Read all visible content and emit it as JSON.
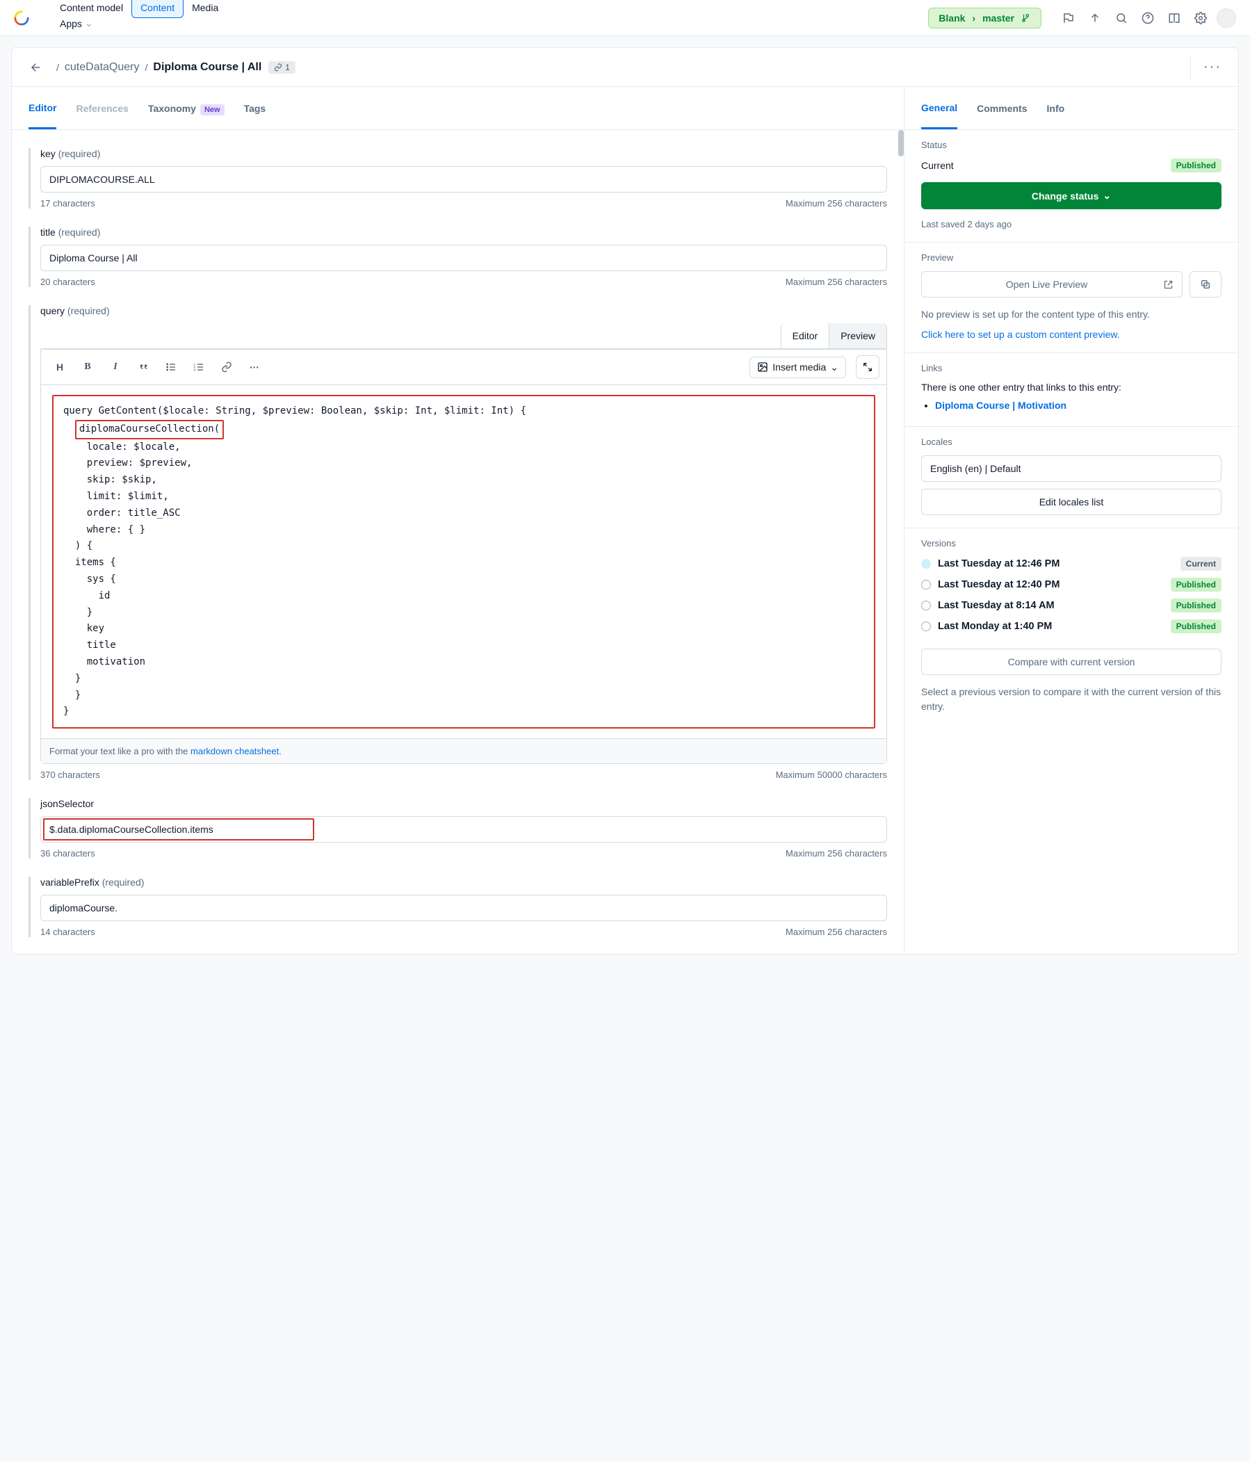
{
  "nav": {
    "items": [
      "Content model",
      "Content",
      "Media",
      "Apps"
    ],
    "active_index": 1
  },
  "env": {
    "space": "Blank",
    "branch": "master"
  },
  "header": {
    "breadcrumb": "cuteDataQuery",
    "title": "Diploma Course | All",
    "link_count": "1"
  },
  "main_tabs": {
    "items": [
      "Editor",
      "References",
      "Taxonomy",
      "Tags"
    ],
    "active_index": 0,
    "new_badge_index": 2,
    "new_label": "New",
    "disabled_index": 1
  },
  "fields": {
    "required_label": "(required)",
    "key": {
      "label": "key",
      "value": "DIPLOMACOURSE.ALL",
      "count": "17 characters",
      "max": "Maximum 256 characters"
    },
    "title": {
      "label": "title",
      "value": "Diploma Course | All",
      "count": "20 characters",
      "max": "Maximum 256 characters"
    },
    "query": {
      "label": "query",
      "tab_editor": "Editor",
      "tab_preview": "Preview",
      "insert_media": "Insert media",
      "code_line1": "query GetContent($locale: String, $preview: Boolean, $skip: Int, $limit: Int) {",
      "code_highlight": "diplomaCourseCollection(",
      "code_rest": "    locale: $locale,\n    preview: $preview,\n    skip: $skip,\n    limit: $limit,\n    order: title_ASC\n    where: { }\n  ) {\n  items {\n    sys {\n      id\n    }\n    key\n    title\n    motivation\n  }\n  }\n}",
      "md_hint_pre": "Format your text like a pro with the ",
      "md_hint_link": "markdown cheatsheet",
      "md_hint_post": ".",
      "count": "370 characters",
      "max": "Maximum 50000 characters"
    },
    "jsonSelector": {
      "label": "jsonSelector",
      "value": "$.data.diplomaCourseCollection.items",
      "count": "36 characters",
      "max": "Maximum 256 characters"
    },
    "variablePrefix": {
      "label": "variablePrefix",
      "value": "diplomaCourse.",
      "count": "14 characters",
      "max": "Maximum 256 characters"
    }
  },
  "side_tabs": {
    "items": [
      "General",
      "Comments",
      "Info"
    ],
    "active_index": 0
  },
  "status": {
    "heading": "Status",
    "current_label": "Current",
    "badge": "Published",
    "change_btn": "Change status",
    "saved": "Last saved 2 days ago"
  },
  "preview": {
    "heading": "Preview",
    "open": "Open Live Preview",
    "note": "No preview is set up for the content type of this entry.",
    "link": "Click here to set up a custom content preview."
  },
  "links": {
    "heading": "Links",
    "note": "There is one other entry that links to this entry:",
    "items": [
      "Diploma Course | Motivation"
    ]
  },
  "locales": {
    "heading": "Locales",
    "value": "English (en) | Default",
    "edit_btn": "Edit locales list"
  },
  "versions": {
    "heading": "Versions",
    "items": [
      {
        "label": "Last Tuesday at 12:46 PM",
        "badge": "Current",
        "badge_style": "grey",
        "filled": true
      },
      {
        "label": "Last Tuesday at 12:40 PM",
        "badge": "Published",
        "badge_style": "green",
        "filled": false
      },
      {
        "label": "Last Tuesday at 8:14 AM",
        "badge": "Published",
        "badge_style": "green",
        "filled": false
      },
      {
        "label": "Last Monday at 1:40 PM",
        "badge": "Published",
        "badge_style": "green",
        "filled": false
      }
    ],
    "compare_btn": "Compare with current version",
    "compare_note": "Select a previous version to compare it with the current version of this entry."
  }
}
